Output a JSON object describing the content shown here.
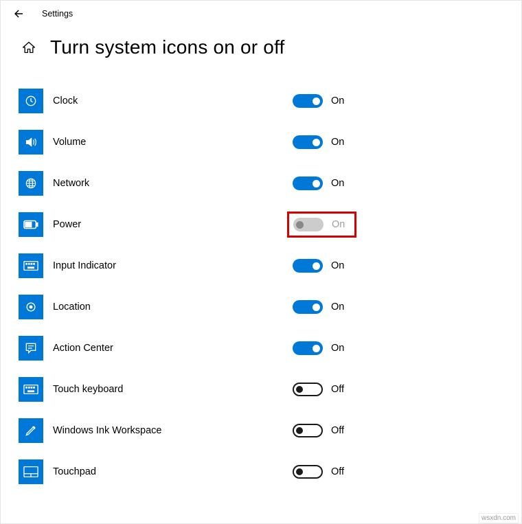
{
  "app": {
    "title": "Settings"
  },
  "page": {
    "title": "Turn system icons on or off"
  },
  "labels": {
    "on": "On",
    "off": "Off"
  },
  "items": [
    {
      "id": "clock",
      "label": "Clock",
      "state": "on"
    },
    {
      "id": "volume",
      "label": "Volume",
      "state": "on"
    },
    {
      "id": "network",
      "label": "Network",
      "state": "on"
    },
    {
      "id": "power",
      "label": "Power",
      "state": "disabled",
      "highlighted": true
    },
    {
      "id": "input-indicator",
      "label": "Input Indicator",
      "state": "on"
    },
    {
      "id": "location",
      "label": "Location",
      "state": "on"
    },
    {
      "id": "action-center",
      "label": "Action Center",
      "state": "on"
    },
    {
      "id": "touch-keyboard",
      "label": "Touch keyboard",
      "state": "off"
    },
    {
      "id": "windows-ink",
      "label": "Windows Ink Workspace",
      "state": "off"
    },
    {
      "id": "touchpad",
      "label": "Touchpad",
      "state": "off"
    }
  ],
  "watermark": "wsxdn.com"
}
